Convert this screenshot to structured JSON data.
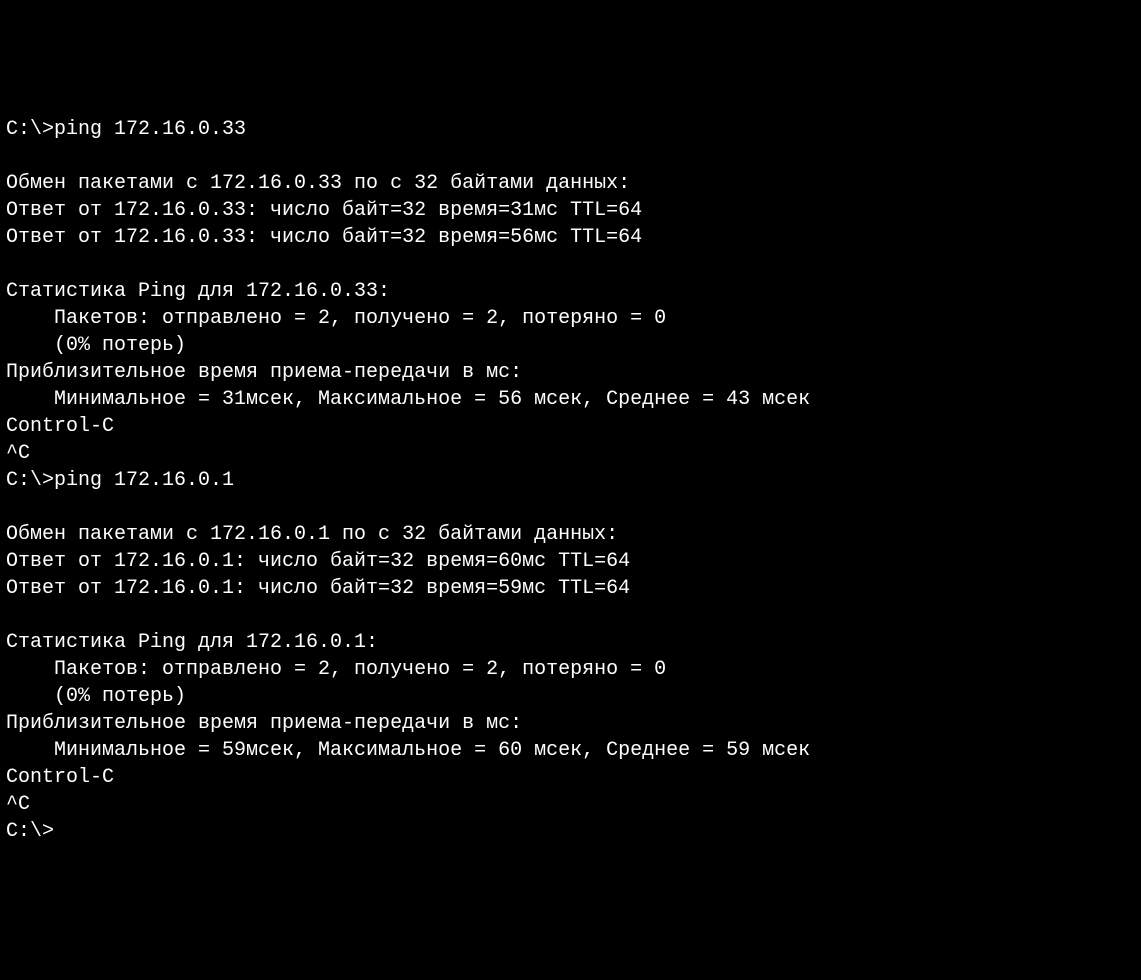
{
  "terminal": {
    "lines": [
      "C:\\>ping 172.16.0.33",
      "",
      "Обмен пакетами с 172.16.0.33 по с 32 байтами данных:",
      "Ответ от 172.16.0.33: число байт=32 время=31мс TTL=64",
      "Ответ от 172.16.0.33: число байт=32 время=56мс TTL=64",
      "",
      "Статистика Ping для 172.16.0.33:",
      "    Пакетов: отправлено = 2, получено = 2, потеряно = 0",
      "    (0% потерь)",
      "Приблизительное время приема-передачи в мс:",
      "    Минимальное = 31мсек, Максимальное = 56 мсек, Среднее = 43 мсек",
      "Control-C",
      "^C",
      "C:\\>ping 172.16.0.1",
      "",
      "Обмен пакетами с 172.16.0.1 по с 32 байтами данных:",
      "Ответ от 172.16.0.1: число байт=32 время=60мс TTL=64",
      "Ответ от 172.16.0.1: число байт=32 время=59мс TTL=64",
      "",
      "Статистика Ping для 172.16.0.1:",
      "    Пакетов: отправлено = 2, получено = 2, потеряно = 0",
      "    (0% потерь)",
      "Приблизительное время приема-передачи в мс:",
      "    Минимальное = 59мсек, Максимальное = 60 мсек, Среднее = 59 мсек",
      "Control-C",
      "^C",
      "C:\\>"
    ]
  }
}
